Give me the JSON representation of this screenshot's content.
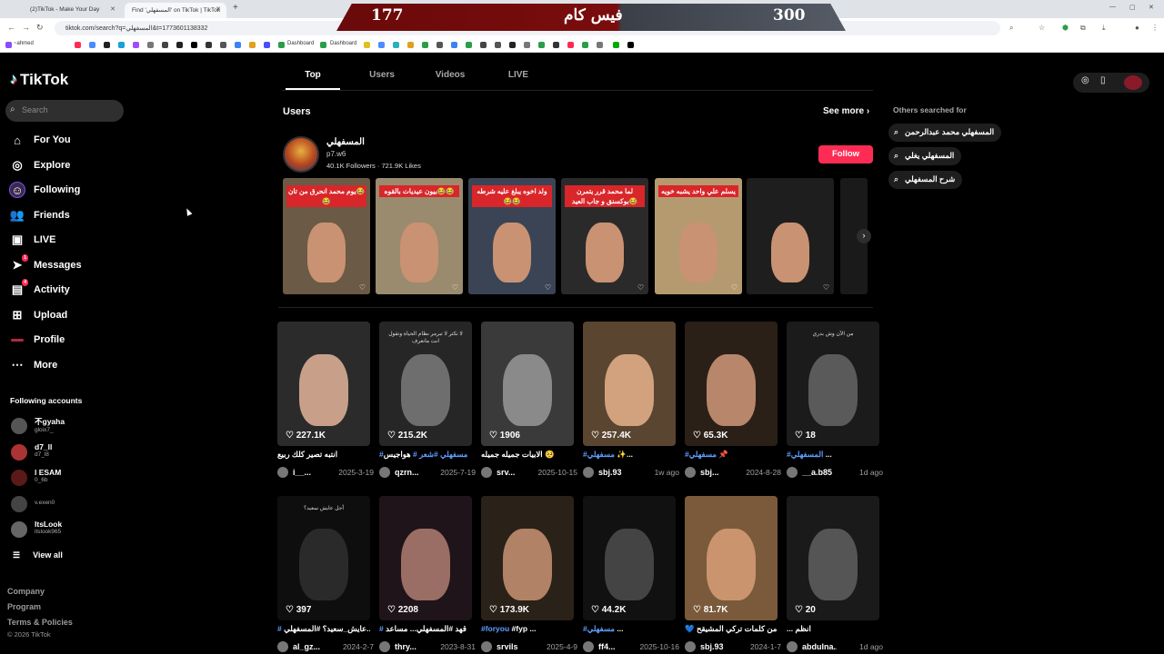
{
  "browser": {
    "tabs": [
      {
        "title": "(2)TikTok - Make Your Day"
      },
      {
        "title": "Find 'المسفهلي' on TikTok | TikTok"
      }
    ],
    "url": "tiktok.com/search?q=المسفهلي&t=1773601138332",
    "bookmarks": [
      {
        "label": "~ahmed"
      },
      {
        "label": "Dashboard"
      },
      {
        "label": "Dashboard"
      }
    ]
  },
  "scoreboard": {
    "left": "177",
    "title": "فيس كام",
    "right": "300"
  },
  "sidebar": {
    "brand": "TikTok",
    "search_placeholder": "Search",
    "nav": [
      {
        "label": "For You",
        "icon": "home-icon"
      },
      {
        "label": "Explore",
        "icon": "compass-icon"
      },
      {
        "label": "Following",
        "icon": "following-icon"
      },
      {
        "label": "Friends",
        "icon": "friends-icon"
      },
      {
        "label": "LIVE",
        "icon": "live-icon"
      },
      {
        "label": "Messages",
        "icon": "messages-icon",
        "badge": "1"
      },
      {
        "label": "Activity",
        "icon": "activity-icon",
        "badge": "4"
      },
      {
        "label": "Upload",
        "icon": "upload-icon"
      },
      {
        "label": "Profile",
        "icon": "profile-icon"
      },
      {
        "label": "More",
        "icon": "more-icon"
      }
    ],
    "following_title": "Following accounts",
    "following": [
      {
        "name": "不gyaha",
        "handle": "gloix7_"
      },
      {
        "name": "d7_ll",
        "handle": "d7_l8"
      },
      {
        "name": "l ESAM",
        "handle": "0_6b"
      },
      {
        "name": "",
        "handle": "v.exen0"
      },
      {
        "name": "ItsLook",
        "handle": "itslook965"
      }
    ],
    "view_all": "View all",
    "footer": [
      "Company",
      "Program",
      "Terms & Policies"
    ],
    "copyright": "© 2026 TikTok"
  },
  "search_tabs": [
    "Top",
    "Users",
    "Videos",
    "LIVE"
  ],
  "users_section": {
    "title": "Users",
    "see_more": "See more",
    "user": {
      "name": "المسفهلي",
      "handle": "p7.w6",
      "followers": "40.1K Followers",
      "likes": "721.9K Likes"
    },
    "follow_label": "Follow",
    "thumbs": [
      {
        "caption": "يوم محمد انحرق من تان😂😂",
        "bg": "#6b5a45"
      },
      {
        "caption": "بيون عيديات بالقوه😂😂",
        "bg": "#9a8a6e"
      },
      {
        "caption": "ولد اخوه يبلغ عليه شرطه😂😂",
        "bg": "#3a4455"
      },
      {
        "caption": "لما محمد قرر يتمرن بوكسنق و جاب العيد😂",
        "bg": "#2a2a2a"
      },
      {
        "caption": "يسلم علي واحد يشبه خويه",
        "bg": "#b59a70"
      },
      {
        "caption": "",
        "bg": "#1e1e1e"
      }
    ]
  },
  "videos_row1": [
    {
      "likes": "227.1K",
      "desc": "انتبه تصير كلك ربيع",
      "tag": "",
      "author": "i__...",
      "date": "2025-3-19",
      "bg": "#2b2b2b",
      "face": "#c8a08a",
      "overlay": ""
    },
    {
      "likes": "215.2K",
      "desc": "هواجيس",
      "tag": "#مسفهلي #شعر #",
      "author": "qzrn...",
      "date": "2025-7-19",
      "bg": "#262626",
      "face": "#6e6e6e",
      "overlay": "لا تكثر لا تبرمر نظام الحياة وتقول انت ماتعرف"
    },
    {
      "likes": "1906",
      "desc": "الابيات جميله جميله 🥺",
      "tag": "",
      "author": "srv...",
      "date": "2025-10-15",
      "bg": "#3a3a3a",
      "face": "#8a8a8a",
      "overlay": ""
    },
    {
      "likes": "257.4K",
      "desc": "✨...",
      "tag": "#مسفهلي",
      "author": "sbj.93",
      "date": "1w ago",
      "bg": "#5a4530",
      "face": "#d2a27e",
      "overlay": ""
    },
    {
      "likes": "65.3K",
      "desc": "📌",
      "tag": "#مسفهلي",
      "author": "sbj...",
      "date": "2024-8-28",
      "bg": "#2a2018",
      "face": "#b8866a",
      "overlay": ""
    },
    {
      "likes": "18",
      "desc": "...",
      "tag": "#المسفهلي",
      "author": "__a.b85",
      "date": "1d ago",
      "bg": "#1b1b1b",
      "face": "#5a5a5a",
      "overlay": "من الآن وش بدري"
    }
  ],
  "videos_row2": [
    {
      "likes": "397",
      "desc": "عايش_سعيد؟ #المسفهلي...",
      "tag": "#",
      "author": "al_gz...",
      "date": "2024-2-7",
      "bg": "#0e0e0e",
      "face": "#2a2a2a",
      "overlay": "أجل عايش سعيد؟"
    },
    {
      "likes": "2208",
      "desc": "قهد #المسفهلي... مساعد",
      "tag": "#",
      "author": "thry...",
      "date": "2023-8-31",
      "bg": "#1f1419",
      "face": "#9a6e64",
      "overlay": ""
    },
    {
      "likes": "173.9K",
      "desc": "#fyp ...",
      "tag": "#foryou",
      "author": "srvils",
      "date": "2025-4-9",
      "bg": "#2a2218",
      "face": "#b28266",
      "overlay": ""
    },
    {
      "likes": "44.2K",
      "desc": "...",
      "tag": "#مسفهلي",
      "author": "ff4...",
      "date": "2025-10-16",
      "bg": "#111",
      "face": "#444",
      "overlay": ""
    },
    {
      "likes": "81.7K",
      "desc": "💙 من كلمات تركي المشيقح",
      "tag": "",
      "author": "sbj.93",
      "date": "2024-1-7",
      "bg": "#7a5a3a",
      "face": "#c9946e",
      "overlay": ""
    },
    {
      "likes": "20",
      "desc": "... انظم",
      "tag": "",
      "author": "abdulna...",
      "date": "1d ago",
      "bg": "#1a1a1a",
      "face": "#555",
      "overlay": ""
    }
  ],
  "others_searched": {
    "title": "Others searched for",
    "items": [
      "المسفهلي محمد عبدالرحمن",
      "المسفهلي يغلي",
      "شرح المسفهلي"
    ]
  },
  "colors": {
    "brand": "#fe2c55",
    "hashtag": "#5ea0ff",
    "bg": "#000000"
  }
}
